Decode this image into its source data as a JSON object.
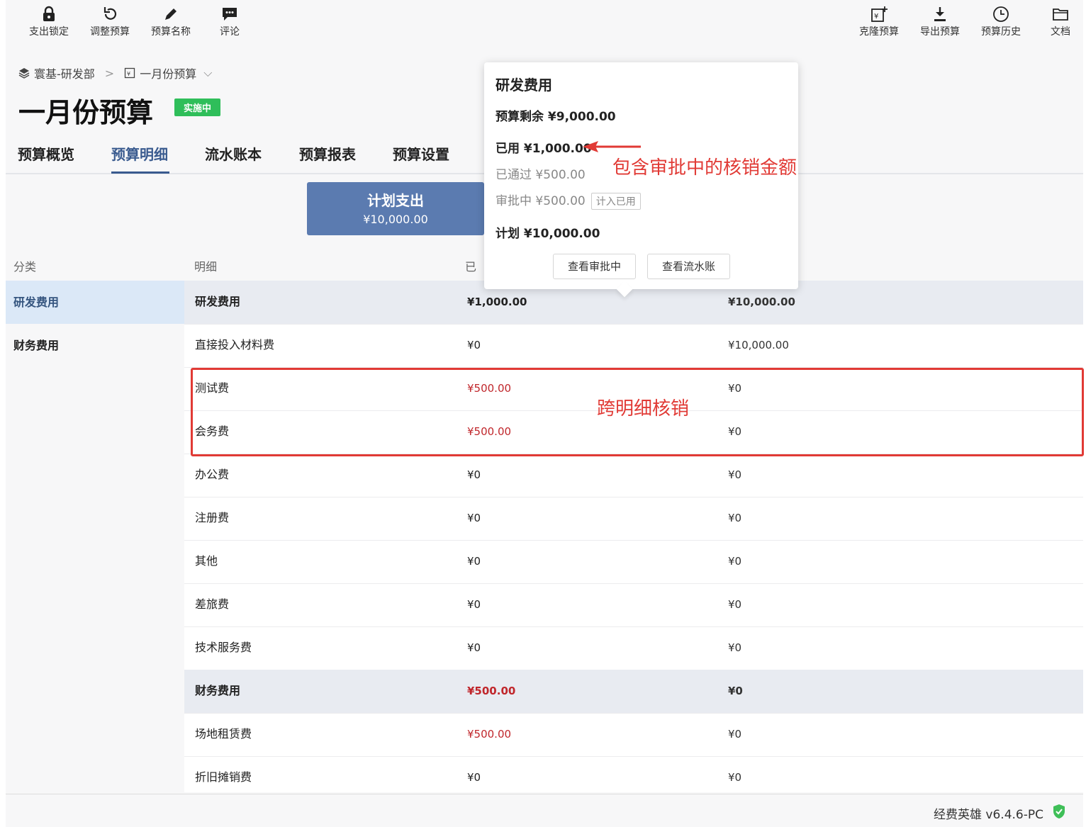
{
  "toolbar_left": [
    {
      "label": "支出锁定",
      "icon": "lock-icon"
    },
    {
      "label": "调整预算",
      "icon": "undo-icon"
    },
    {
      "label": "预算名称",
      "icon": "pencil-icon"
    },
    {
      "label": "评论",
      "icon": "comment-icon"
    }
  ],
  "toolbar_right": [
    {
      "label": "克隆预算",
      "icon": "clone-icon"
    },
    {
      "label": "导出预算",
      "icon": "download-icon"
    },
    {
      "label": "预算历史",
      "icon": "clock-icon"
    },
    {
      "label": "文档",
      "icon": "folder-icon"
    }
  ],
  "breadcrumb": {
    "org": "寰基-研发部",
    "budget": "一月份预算"
  },
  "page": {
    "title": "一月份预算",
    "status": "实施中"
  },
  "tabs": [
    "预算概览",
    "预算明细",
    "流水账本",
    "预算报表",
    "预算设置"
  ],
  "plan_card": {
    "title": "计划支出",
    "value": "¥10,000.00"
  },
  "columns": {
    "category": "分类",
    "detail": "明细",
    "used": "已"
  },
  "categories": [
    "研发费用",
    "财务费用"
  ],
  "rows": [
    {
      "name": "研发费用",
      "used": "¥1,000.00",
      "plan": "¥10,000.00",
      "group": true,
      "used_red": false
    },
    {
      "name": "直接投入材料费",
      "used": "¥0",
      "plan": "¥10,000.00",
      "group": false,
      "used_red": false
    },
    {
      "name": "测试费",
      "used": "¥500.00",
      "plan": "¥0",
      "group": false,
      "used_red": true
    },
    {
      "name": "会务费",
      "used": "¥500.00",
      "plan": "¥0",
      "group": false,
      "used_red": true
    },
    {
      "name": "办公费",
      "used": "¥0",
      "plan": "¥0",
      "group": false,
      "used_red": false
    },
    {
      "name": "注册费",
      "used": "¥0",
      "plan": "¥0",
      "group": false,
      "used_red": false
    },
    {
      "name": "其他",
      "used": "¥0",
      "plan": "¥0",
      "group": false,
      "used_red": false
    },
    {
      "name": "差旅费",
      "used": "¥0",
      "plan": "¥0",
      "group": false,
      "used_red": false
    },
    {
      "name": "技术服务费",
      "used": "¥0",
      "plan": "¥0",
      "group": false,
      "used_red": false
    },
    {
      "name": "财务费用",
      "used": "¥500.00",
      "plan": "¥0",
      "group": true,
      "used_red": true
    },
    {
      "name": "场地租赁费",
      "used": "¥500.00",
      "plan": "¥0",
      "group": false,
      "used_red": true
    },
    {
      "name": "折旧摊销费",
      "used": "¥0",
      "plan": "¥0",
      "group": false,
      "used_red": false
    }
  ],
  "popover": {
    "title": "研发费用",
    "remain": "预算剩余 ¥9,000.00",
    "used": "已用 ¥1,000.00",
    "passed": "已通过 ¥500.00",
    "pending": "审批中 ¥500.00",
    "pending_tag": "计入已用",
    "plan": "计划 ¥10,000.00",
    "btn_pending": "查看审批中",
    "btn_ledger": "查看流水账"
  },
  "annotations": {
    "used_note": "包含审批中的核销金额",
    "cross_note": "跨明细核销"
  },
  "footer": {
    "version": "经费英雄 v6.4.6-PC"
  },
  "colors": {
    "accent": "#3a5b8f",
    "badge": "#2fbe5a",
    "red": "#c0262b",
    "annotation": "#e13a35"
  }
}
